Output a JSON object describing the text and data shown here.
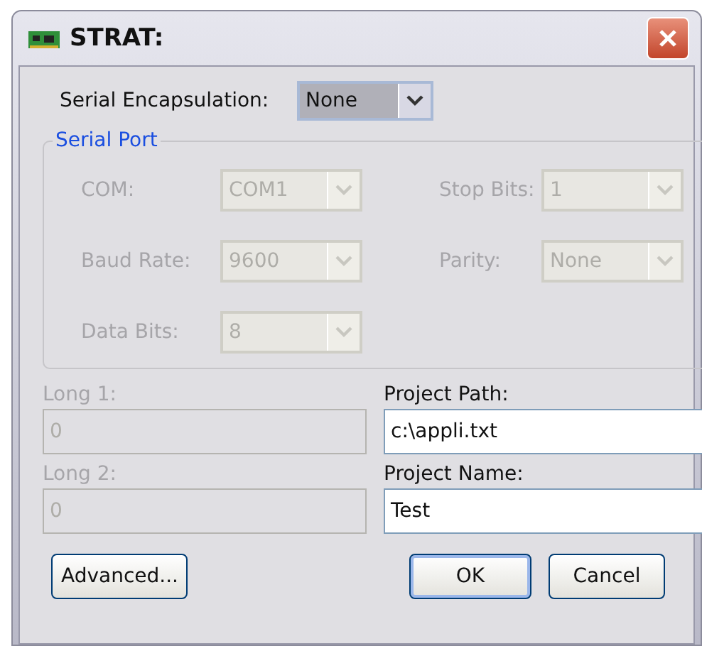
{
  "window": {
    "title": "STRAT:"
  },
  "encapsulation": {
    "label": "Serial Encapsulation:",
    "value": "None",
    "disabled": false
  },
  "serial_port": {
    "title": "Serial Port",
    "fields": [
      {
        "label": "COM:",
        "value": "COM1",
        "disabled": true
      },
      {
        "label": "Stop Bits:",
        "value": "1",
        "disabled": true
      },
      {
        "label": "Baud Rate:",
        "value": "9600",
        "disabled": true
      },
      {
        "label": "Parity:",
        "value": "None",
        "disabled": true
      },
      {
        "label": "Data Bits:",
        "value": "8",
        "disabled": true
      }
    ]
  },
  "text_fields": [
    {
      "label": "Long 1:",
      "value": "0",
      "disabled": true
    },
    {
      "label": "Project Path:",
      "value": "c:\\appli.txt",
      "disabled": false
    },
    {
      "label": "Long 2:",
      "value": "0",
      "disabled": true
    },
    {
      "label": "Project Name:",
      "value": "Test",
      "disabled": false
    }
  ],
  "buttons": [
    {
      "label": "Advanced...",
      "default": false
    },
    {
      "label": "OK",
      "default": true
    },
    {
      "label": "Cancel",
      "default": false
    }
  ]
}
